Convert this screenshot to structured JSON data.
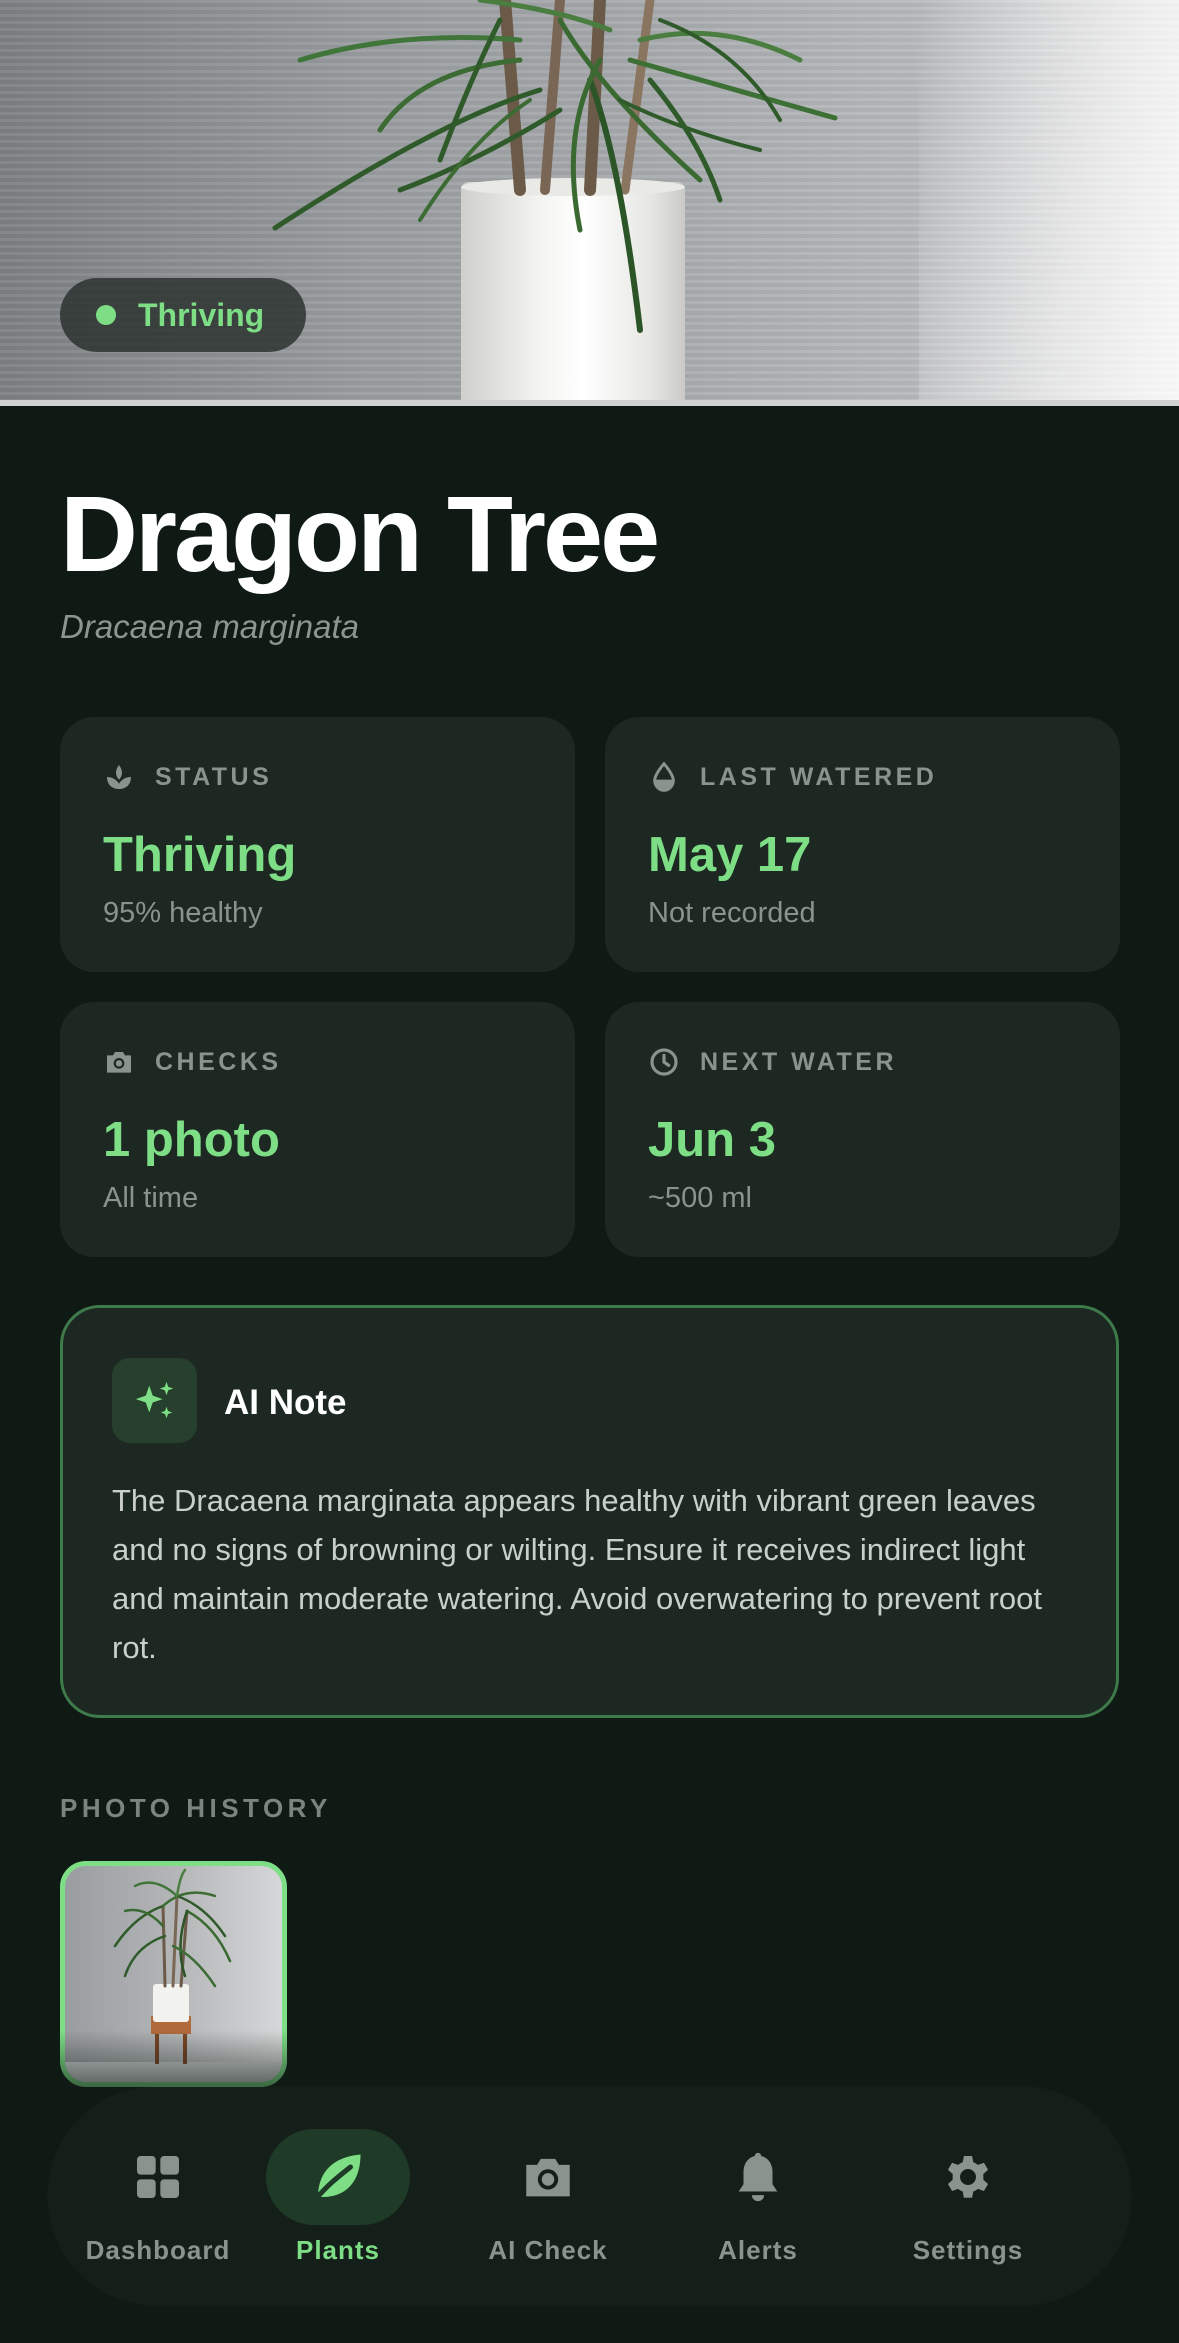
{
  "hero": {
    "status_chip": "Thriving",
    "accent": "#7dde86"
  },
  "plant": {
    "name": "Dragon Tree",
    "scientific_name": "Dracaena marginata"
  },
  "stats": [
    {
      "icon": "plant-sprout-icon",
      "label": "STATUS",
      "value": "Thriving",
      "sub": "95% healthy"
    },
    {
      "icon": "water-drop-icon",
      "label": "LAST WATERED",
      "value": "May 17",
      "sub": "Not recorded"
    },
    {
      "icon": "camera-icon",
      "label": "CHECKS",
      "value": "1 photo",
      "sub": "All time"
    },
    {
      "icon": "clock-icon",
      "label": "NEXT WATER",
      "value": "Jun 3",
      "sub": "~500 ml"
    }
  ],
  "ai_note": {
    "icon": "sparkles-icon",
    "title": "AI Note",
    "body": "The Dracaena marginata appears healthy with vibrant green leaves and no signs of browning or wilting. Ensure it receives indirect light and maintain moderate watering. Avoid overwatering to prevent root rot."
  },
  "photo_history": {
    "label": "PHOTO HISTORY"
  },
  "nav": {
    "items": [
      {
        "label": "Dashboard",
        "icon": "grid-icon",
        "active": false
      },
      {
        "label": "Plants",
        "icon": "leaf-icon",
        "active": true
      },
      {
        "label": "AI Check",
        "icon": "camera-icon",
        "active": false
      },
      {
        "label": "Alerts",
        "icon": "bell-icon",
        "active": false
      },
      {
        "label": "Settings",
        "icon": "gear-icon",
        "active": false
      }
    ]
  }
}
